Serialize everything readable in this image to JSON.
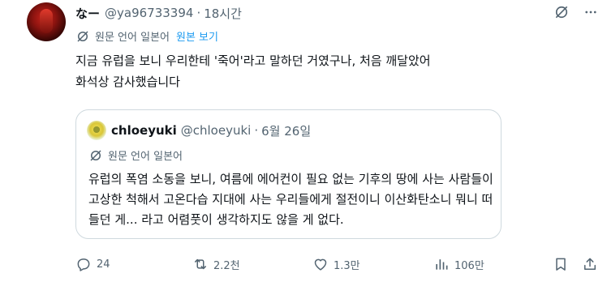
{
  "post": {
    "author_name": "なー",
    "author_handle": "@ya96733394",
    "separator": "·",
    "time": "18시간",
    "translate": {
      "original_lang": "원문 언어 일본어",
      "show_original": "원본 보기"
    },
    "text_line1": "지금 유럽을 보니 우리한테 '죽어'라고 말하던 거였구나, 처음 깨달았어",
    "text_line2": "화석상 감사했습니다"
  },
  "quote": {
    "author_name": "chloeyuki",
    "author_handle": "@chloeyuki",
    "separator": "·",
    "date": "6월 26일",
    "translate_label": "원문 언어 일본어",
    "text_line1": "유럽의 폭염 소동을 보니, 여름에 에어컨이 필요 없는 기후의 땅에 사는 사람들이",
    "text_line2": "고상한 척해서 고온다습 지대에 사는 우리들에게 절전이니 이산화탄소니 뭐니 떠",
    "text_line3": "들던 게... 라고 어렴풋이 생각하지도 않을 게 없다."
  },
  "actions": {
    "replies": "24",
    "reposts": "2.2천",
    "likes": "1.3만",
    "views": "106만"
  },
  "icons": {
    "grok": "grok-icon",
    "translate": "translate-icon",
    "reply": "reply-icon",
    "repost": "repost-icon",
    "like": "heart-icon",
    "views": "views-icon",
    "bookmark": "bookmark-icon",
    "share": "share-icon"
  },
  "colors": {
    "text": "#0f1419",
    "secondary": "#536471",
    "link": "#1d9bf0",
    "border": "#cfd9de"
  }
}
